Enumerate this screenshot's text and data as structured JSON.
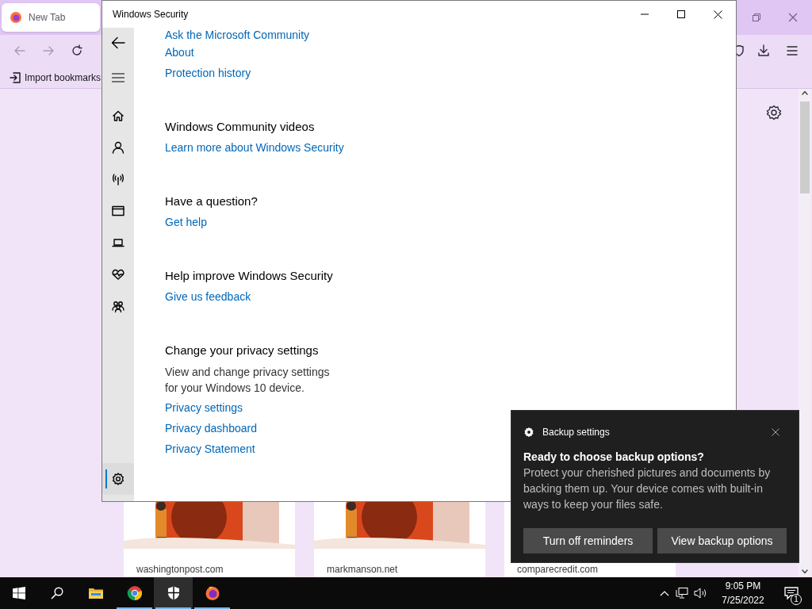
{
  "browser": {
    "tabs": [
      {
        "title": "New Tab",
        "selected": true
      }
    ],
    "bookmarks": [
      {
        "label": "Import bookmarks"
      }
    ],
    "tiles": [
      {
        "label": "washingtonpost.com",
        "kind": "picture"
      },
      {
        "label": "markmanson.net",
        "kind": "picture"
      },
      {
        "label": "comparecredit.com"
      }
    ]
  },
  "security_window": {
    "title": "Windows Security",
    "nav": [
      {
        "selected": false
      },
      {
        "selected": false
      },
      {
        "selected": false
      },
      {
        "selected": false
      },
      {
        "selected": false
      },
      {
        "selected": false
      },
      {
        "selected": false
      },
      {
        "selected": true
      }
    ],
    "sections": [
      {
        "links": [
          "Ask the Microsoft Community",
          "About",
          "Protection history"
        ]
      },
      {
        "heading": "Windows Community videos",
        "links": [
          "Learn more about Windows Security"
        ]
      },
      {
        "heading": "Have a question?",
        "links": [
          "Get help"
        ]
      },
      {
        "heading": "Help improve Windows Security",
        "links": [
          "Give us feedback"
        ]
      },
      {
        "heading": "Change your privacy settings",
        "text": "View and change privacy settings for your Windows 10 device.",
        "links": [
          "Privacy settings",
          "Privacy dashboard",
          "Privacy Statement"
        ]
      }
    ]
  },
  "toast": {
    "app": "Backup settings",
    "title": "Ready to choose backup options?",
    "body": "Protect your cherished pictures and documents by backing them up. Your device comes with built-in ways to keep your files safe.",
    "buttons": [
      "Turn off reminders",
      "View backup options"
    ]
  },
  "taskbar": {
    "apps": [
      {
        "running": false,
        "active": false
      },
      {
        "running": true,
        "active": false
      },
      {
        "running": true,
        "active": true
      },
      {
        "running": true,
        "active": false
      }
    ],
    "time": "9:05 PM",
    "date": "7/25/2022",
    "notifications": "1"
  }
}
